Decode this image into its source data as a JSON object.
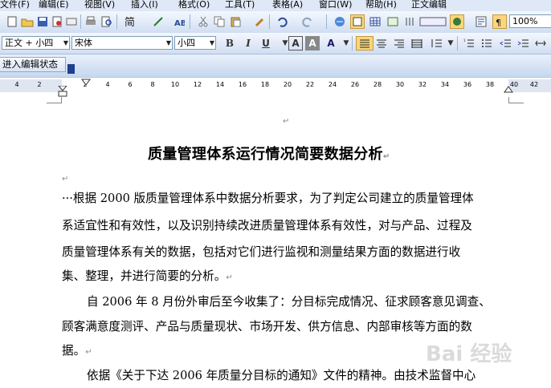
{
  "menubar": {
    "items": [
      "文件(F)",
      "编辑(E)",
      "视图(V)",
      "插入(I)",
      "格式(O)",
      "工具(T)",
      "表格(A)",
      "窗口(W)",
      "帮助(H)",
      "正文编辑"
    ]
  },
  "toolbar_std": {
    "zoom_value": "100%",
    "icons": [
      "new-icon",
      "open-icon",
      "save-icon",
      "permission-icon",
      "email-icon",
      "print-icon",
      "print-preview-icon",
      "spelling-icon",
      "research-icon",
      "cut-icon",
      "copy-icon",
      "paste-icon",
      "format-painter-icon",
      "undo-icon",
      "redo-icon",
      "hyperlink-icon",
      "tables-icon",
      "insert-table-icon",
      "excel-icon",
      "columns-icon",
      "drawing-icon",
      "document-map-icon",
      "show-hide-icon",
      "zoom-icon"
    ]
  },
  "toolbar_fmt": {
    "style_value": "正文 + 小四",
    "font_value": "宋体",
    "size_value": "小四",
    "bold_label": "B",
    "italic_label": "I",
    "underline_label": "U",
    "char_border_label": "A",
    "char_shade_label": "A",
    "char_scale_label": "A"
  },
  "toolbar_edit": {
    "enter_edit_label": "进入编辑状态"
  },
  "ruler": {
    "ticks": [
      "4",
      "2",
      "",
      "2",
      "4",
      "6",
      "8",
      "10",
      "12",
      "14",
      "16",
      "18",
      "20",
      "22",
      "24",
      "26",
      "28",
      "30",
      "32",
      "34",
      "36",
      "38",
      "40",
      "42"
    ]
  },
  "document": {
    "para_mark": "↵",
    "title": "质量管理体系运行情况简要数据分析",
    "lines": [
      "···根据 2000 版质量管理体系中数据分析要求，为了判定公司建立的质量管理体",
      "系适宜性和有效性，以及识别持续改进质量管理体系有效性，对与产品、过程及",
      "质量管理体系有关的数据，包括对它们进行监视和测量结果方面的数据进行收",
      "集、整理，并进行简要的分析。",
      "自 2006 年 8 月份外审后至今收集了：分目标完成情况、征求顾客意见调查、",
      "顾客满意度测评、产品与质量现状、市场开发、供方信息、内部审核等方面的数",
      "据。",
      "依据《关于下达 2006 年质量分目标的通知》文件的精神。由技术监督中心"
    ]
  },
  "watermark": "Bai 经验"
}
